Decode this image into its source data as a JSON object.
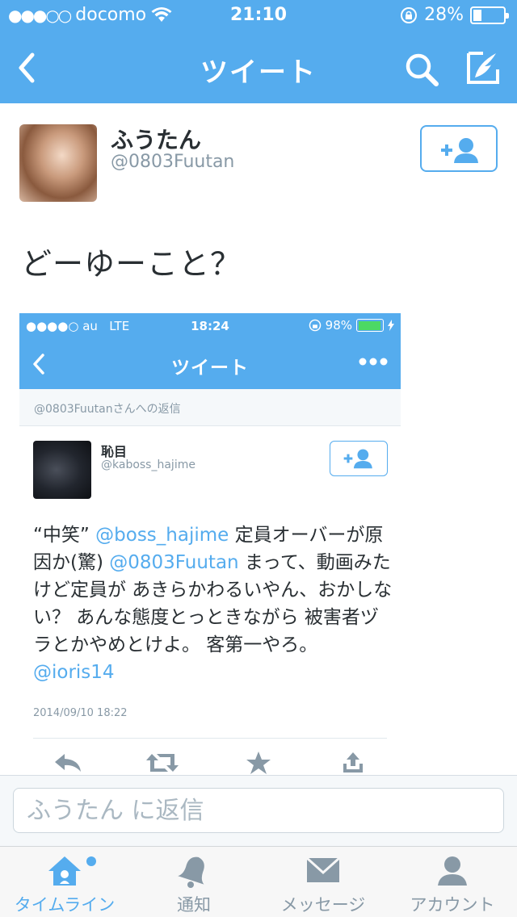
{
  "status_bar": {
    "signal_dots": "●●●○○",
    "carrier": "docomo",
    "time": "21:10",
    "battery_percent": "28%"
  },
  "nav": {
    "title": "ツイート"
  },
  "tweet": {
    "author_name": "ふうたん",
    "author_handle": "@0803Fuutan",
    "text": "どーゆーこと？"
  },
  "embedded": {
    "status_bar": {
      "signal": "●●●●○",
      "carrier": "au",
      "network": "LTE",
      "time": "18:24",
      "battery_percent": "98%"
    },
    "nav_title": "ツイート",
    "reply_to": "@0803Fuutanさんへの返信",
    "author_name": "恥目",
    "author_handle": "@kaboss_hajime",
    "text_parts": {
      "p1": "“中笑” ",
      "m1": "@boss_hajime",
      "p2": " 定員オーバーが原因か(驚) ",
      "m2": "@0803Fuutan",
      "p3": " まって、動画みたけど定員が あきらかわるいやん、おかしない？ あんな態度とっときながら 被害者ヅラとかやめとけよ。 客第一やろ。 ",
      "m3": "@ioris14"
    },
    "date": "2014/09/10 18:22"
  },
  "reply": {
    "placeholder": "ふうたん に返信"
  },
  "tabs": [
    {
      "label": "タイムライン",
      "icon": "home-icon",
      "active": true
    },
    {
      "label": "通知",
      "icon": "bell-icon",
      "active": false
    },
    {
      "label": "メッセージ",
      "icon": "envelope-icon",
      "active": false
    },
    {
      "label": "アカウント",
      "icon": "person-icon",
      "active": false
    }
  ],
  "colors": {
    "brand": "#55acee",
    "text": "#292f33",
    "muted": "#8899a6"
  }
}
